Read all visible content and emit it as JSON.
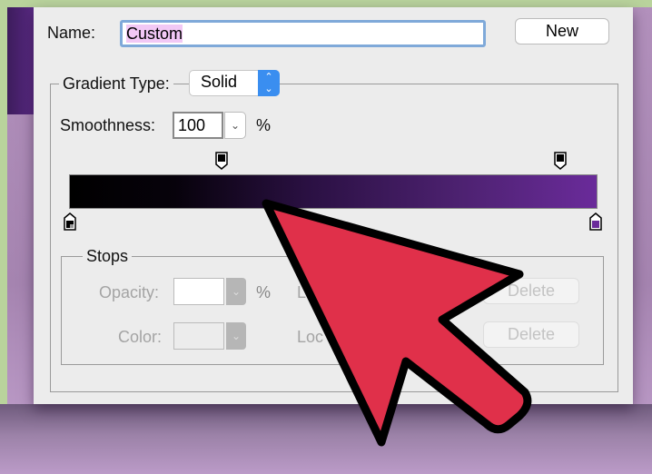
{
  "dialog": {
    "name_label": "Name:",
    "name_value": "Custom",
    "new_button": "New",
    "gradient_type_label": "Gradient Type:",
    "gradient_type_value": "Solid",
    "smoothness_label": "Smoothness:",
    "smoothness_value": "100",
    "smoothness_unit": "%",
    "gradient": {
      "start_color": "#000000",
      "end_color": "#6a2b9a"
    },
    "stops": {
      "title": "Stops",
      "opacity_label": "Opacity:",
      "opacity_unit": "%",
      "location_label_1": "L",
      "color_label": "Color:",
      "location_label_2": "Loc",
      "delete_1": "Delete",
      "delete_2": "Delete"
    }
  },
  "overlay": {
    "arrow_color": "#e0304a",
    "arrow_icon": "cursor-arrow-icon"
  }
}
